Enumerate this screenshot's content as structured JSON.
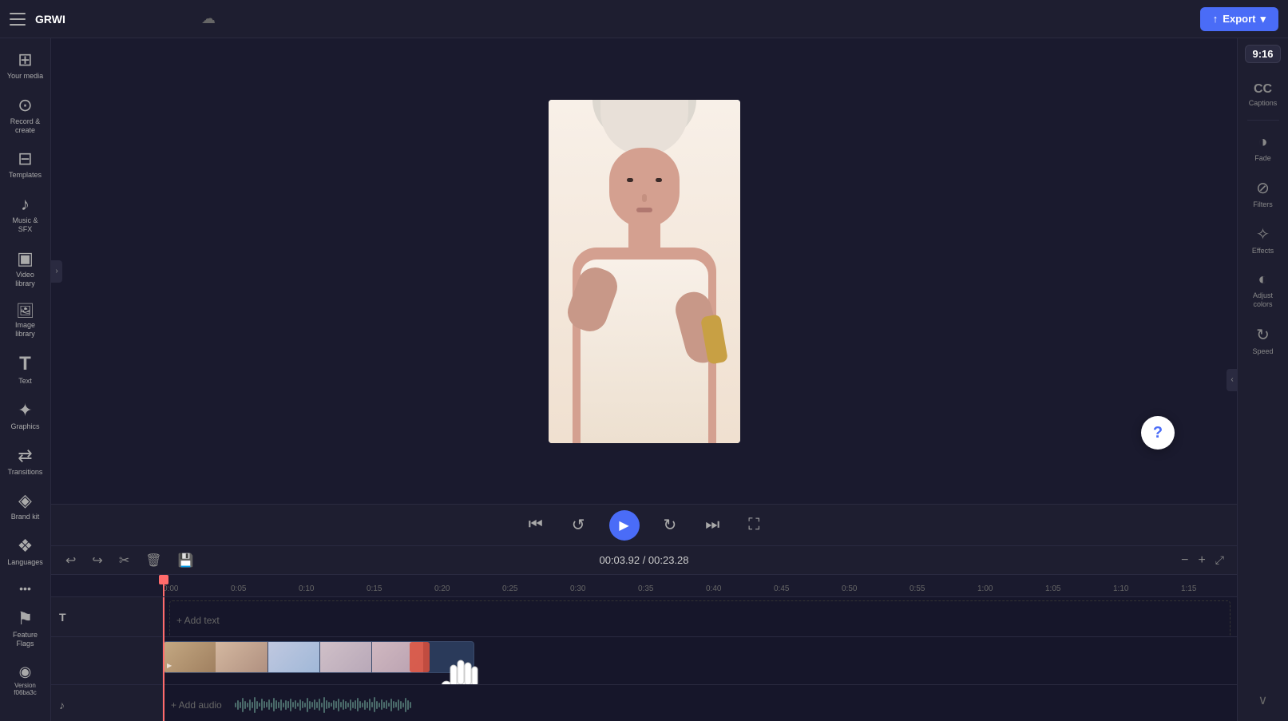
{
  "header": {
    "menu_icon": "☰",
    "project_title": "GRWI",
    "cloud_icon": "☁",
    "export_label": "Export",
    "export_icon": "↑",
    "export_chevron": "▾"
  },
  "sidebar": {
    "items": [
      {
        "id": "your-media",
        "icon": "⊞",
        "label": "Your media"
      },
      {
        "id": "record",
        "icon": "⊙",
        "label": "Record &\ncreate"
      },
      {
        "id": "templates",
        "icon": "⊟",
        "label": "Templates"
      },
      {
        "id": "music-sfx",
        "icon": "♪",
        "label": "Music & SFX"
      },
      {
        "id": "video-library",
        "icon": "▣",
        "label": "Video library"
      },
      {
        "id": "image-library",
        "icon": "🖼",
        "label": "Image library"
      },
      {
        "id": "text",
        "icon": "T",
        "label": "Text"
      },
      {
        "id": "graphics",
        "icon": "✦",
        "label": "Graphics"
      },
      {
        "id": "transitions",
        "icon": "⇄",
        "label": "Transitions"
      },
      {
        "id": "brand-kit",
        "icon": "◈",
        "label": "Brand kit"
      },
      {
        "id": "languages",
        "icon": "❖",
        "label": "Languages"
      },
      {
        "id": "more",
        "icon": "···",
        "label": ""
      },
      {
        "id": "feature-flags",
        "icon": "⚑",
        "label": "Feature Flags"
      },
      {
        "id": "version",
        "icon": "◉",
        "label": "Version\nf06ba3c"
      }
    ]
  },
  "right_sidebar": {
    "items": [
      {
        "id": "captions",
        "icon": "CC",
        "label": "Captions"
      },
      {
        "id": "fade",
        "icon": "◑",
        "label": "Fade"
      },
      {
        "id": "filters",
        "icon": "⊘",
        "label": "Filters"
      },
      {
        "id": "effects",
        "icon": "✧",
        "label": "Effects"
      },
      {
        "id": "adjust-colors",
        "icon": "◐",
        "label": "Adjust colors"
      },
      {
        "id": "speed",
        "icon": "↻",
        "label": "Speed"
      }
    ],
    "aspect_ratio": "9:16"
  },
  "preview": {
    "current_time": "00:03.92",
    "total_time": "00:23.28",
    "time_display": "00:03.92 / 00:23.28"
  },
  "controls": {
    "skip_back": "⏮",
    "rewind": "↺",
    "play": "▶",
    "forward": "↻",
    "skip_forward": "⏭",
    "fullscreen": "⛶"
  },
  "timeline": {
    "toolbar": {
      "undo": "↩",
      "redo": "↪",
      "cut": "✂",
      "delete": "🗑",
      "save": "💾"
    },
    "time_display": "00:03.92 / 00:23.28",
    "ruler_marks": [
      "0:00",
      "0:05",
      "0:10",
      "0:15",
      "0:20",
      "0:25",
      "0:30",
      "0:35",
      "0:40",
      "0:45",
      "0:50",
      "0:55",
      "1:00",
      "1:05",
      "1:10",
      "1:15"
    ],
    "tracks": [
      {
        "id": "text-track",
        "icon": "T",
        "label": "Add text",
        "type": "text"
      },
      {
        "id": "video-track",
        "icon": "",
        "label": "",
        "type": "video"
      },
      {
        "id": "audio-track",
        "icon": "♪",
        "label": "Add audio",
        "type": "audio"
      }
    ]
  },
  "annotations": {
    "arrow_label": "drag arrow",
    "cursor_label": "cursor pointer"
  }
}
